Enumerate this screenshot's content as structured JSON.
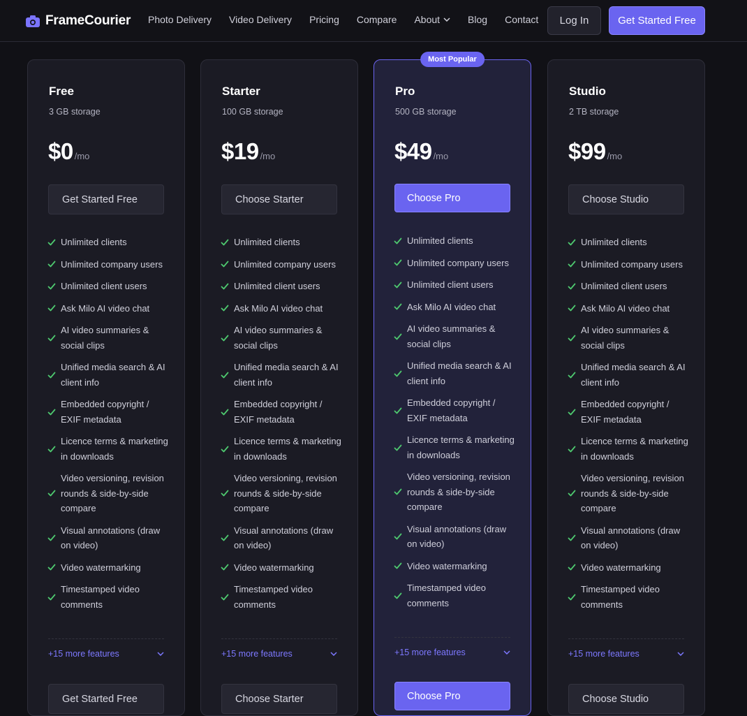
{
  "nav": {
    "brand": "FrameCourier",
    "brand_icon": "camera-icon",
    "links": [
      "Photo Delivery",
      "Video Delivery",
      "Pricing",
      "Compare",
      "About",
      "Blog",
      "Contact"
    ],
    "login": "Log In",
    "cta": "Get Started Free"
  },
  "colors": {
    "accent": "#6a64f0",
    "check": "#4ec96f",
    "background": "#111116",
    "card": "#1b1b24"
  },
  "plans": [
    {
      "name": "Free",
      "storage": "3 GB storage",
      "price": "$0",
      "per": "/mo",
      "button": "Get Started Free",
      "button_bottom": "Get Started Free",
      "more": "+15 more features"
    },
    {
      "name": "Starter",
      "storage": "100 GB storage",
      "price": "$19",
      "per": "/mo",
      "button": "Choose Starter",
      "button_bottom": "Choose Starter",
      "more": "+15 more features"
    },
    {
      "name": "Pro",
      "storage": "500 GB storage",
      "price": "$49",
      "per": "/mo",
      "button": "Choose Pro",
      "button_bottom": "Choose Pro",
      "more": "+15 more features",
      "badge": "Most Popular"
    },
    {
      "name": "Studio",
      "storage": "2 TB storage",
      "price": "$99",
      "per": "/mo",
      "button": "Choose Studio",
      "button_bottom": "Choose Studio",
      "more": "+15 more features"
    }
  ],
  "features": [
    "Unlimited clients",
    "Unlimited company users",
    "Unlimited client users",
    "Ask Milo AI video chat",
    "AI video summaries & social clips",
    "Unified media search & AI client info",
    "Embedded copyright / EXIF metadata",
    "Licence terms & marketing in downloads",
    "Video versioning, revision rounds & side-by-side compare",
    "Visual annotations (draw on video)",
    "Video watermarking",
    "Timestamped video comments"
  ]
}
